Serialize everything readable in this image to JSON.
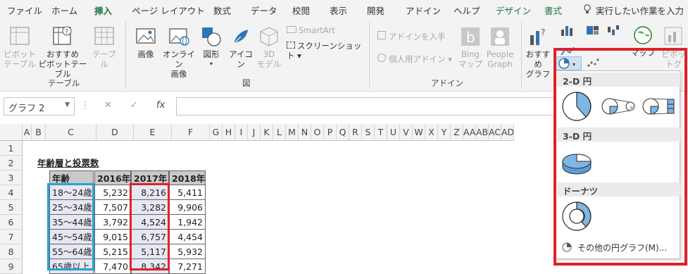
{
  "ribbon_tabs": [
    "ファイル",
    "ホーム",
    "挿入",
    "ページ レイアウト",
    "数式",
    "データ",
    "校閲",
    "表示",
    "開発",
    "アドイン",
    "ヘルプ",
    "デザイン",
    "書式"
  ],
  "tell_me": "実行したい作業を入力",
  "groups": {
    "table": {
      "name": "テーブル",
      "pivot": "ピボット\nテーブル",
      "recommended_pivot": "おすすめ\nピボットテーブル",
      "table": "テーブル"
    },
    "figure": {
      "name": "図",
      "image": "画像",
      "online_image": "オンライン\n画像",
      "shapes": "図形",
      "icons": "アイコン",
      "model3d": "3D\nモデル",
      "smartart": "SmartArt",
      "screenshot": "スクリーンショット"
    },
    "addin": {
      "name": "アドイン",
      "get_addin": "アドインを入手",
      "my_addin": "個人用アドイン",
      "bing": "Bing\nマップ",
      "people": "People\nGraph"
    },
    "chart": {
      "recommended": "おすすめ\nグラフ",
      "map": "マップ",
      "pivotchart": "ピボットグ"
    }
  },
  "name_box": "グラフ 2",
  "fx": "fx",
  "columns": [
    "A",
    "B",
    "C",
    "D",
    "E",
    "F",
    "G",
    "H",
    "I",
    "J",
    "K",
    "L",
    "M",
    "N",
    "O",
    "P",
    "Q",
    "R",
    "S",
    "T",
    "U",
    "V",
    "W",
    "X",
    "Y",
    "Z",
    "AA",
    "AB",
    "AC",
    "AD"
  ],
  "rows": [
    "1",
    "2",
    "3",
    "4",
    "5",
    "6",
    "7",
    "8",
    "9"
  ],
  "sheet": {
    "title": "年齢層と投票数",
    "headers": [
      "年齢",
      "2016年",
      "2017年",
      "2018年"
    ],
    "data": [
      [
        "18～24歳",
        "5,232",
        "8,216",
        "5,411"
      ],
      [
        "25～34歳",
        "7,507",
        "3,282",
        "9,906"
      ],
      [
        "35～44歳",
        "3,792",
        "4,524",
        "1,942"
      ],
      [
        "45～54歳",
        "9,015",
        "6,757",
        "4,454"
      ],
      [
        "55～64歳",
        "5,215",
        "5,117",
        "5,932"
      ],
      [
        "65歳以上",
        "7,470",
        "8,342",
        "7,271"
      ]
    ]
  },
  "pie_menu": {
    "section_2d": "2-D 円",
    "section_3d": "3-D 円",
    "section_donut": "ドーナツ",
    "more": "その他の円グラフ(M)..."
  },
  "colors": {
    "accent": "#217346",
    "pie_fill": "#7fb6e3",
    "highlight_blue": "#27a2d9",
    "highlight_red": "#e0202a"
  }
}
